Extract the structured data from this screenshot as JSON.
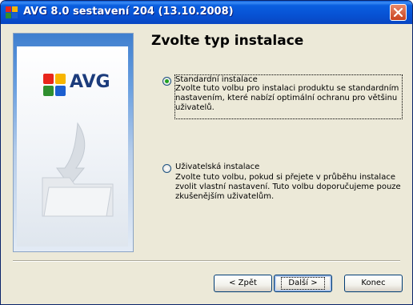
{
  "window": {
    "title": "AVG 8.0 sestavení 204 (13.10.2008)",
    "close_label": "close"
  },
  "banner": {
    "logo_text": "AVG"
  },
  "page": {
    "heading": "Zvolte typ instalace"
  },
  "options": [
    {
      "label": "Standardní instalace",
      "description": "Zvolte tuto volbu pro instalaci produktu se standardním nastavením, které nabízí optimální ochranu pro většinu uživatelů.",
      "selected": true
    },
    {
      "label": "Uživatelská instalace",
      "description": "Zvolte tuto volbu, pokud si přejete v průběhu instalace zvolit vlastní nastavení. Tuto volbu doporučujeme pouze zkušenějším uživatelům.",
      "selected": false
    }
  ],
  "buttons": {
    "back": "< Zpět",
    "next": "Další >",
    "cancel": "Konec"
  },
  "colors": {
    "titlebar": "#0752d4",
    "dialog_bg": "#ece9d8",
    "radio_dot": "#21a121"
  }
}
